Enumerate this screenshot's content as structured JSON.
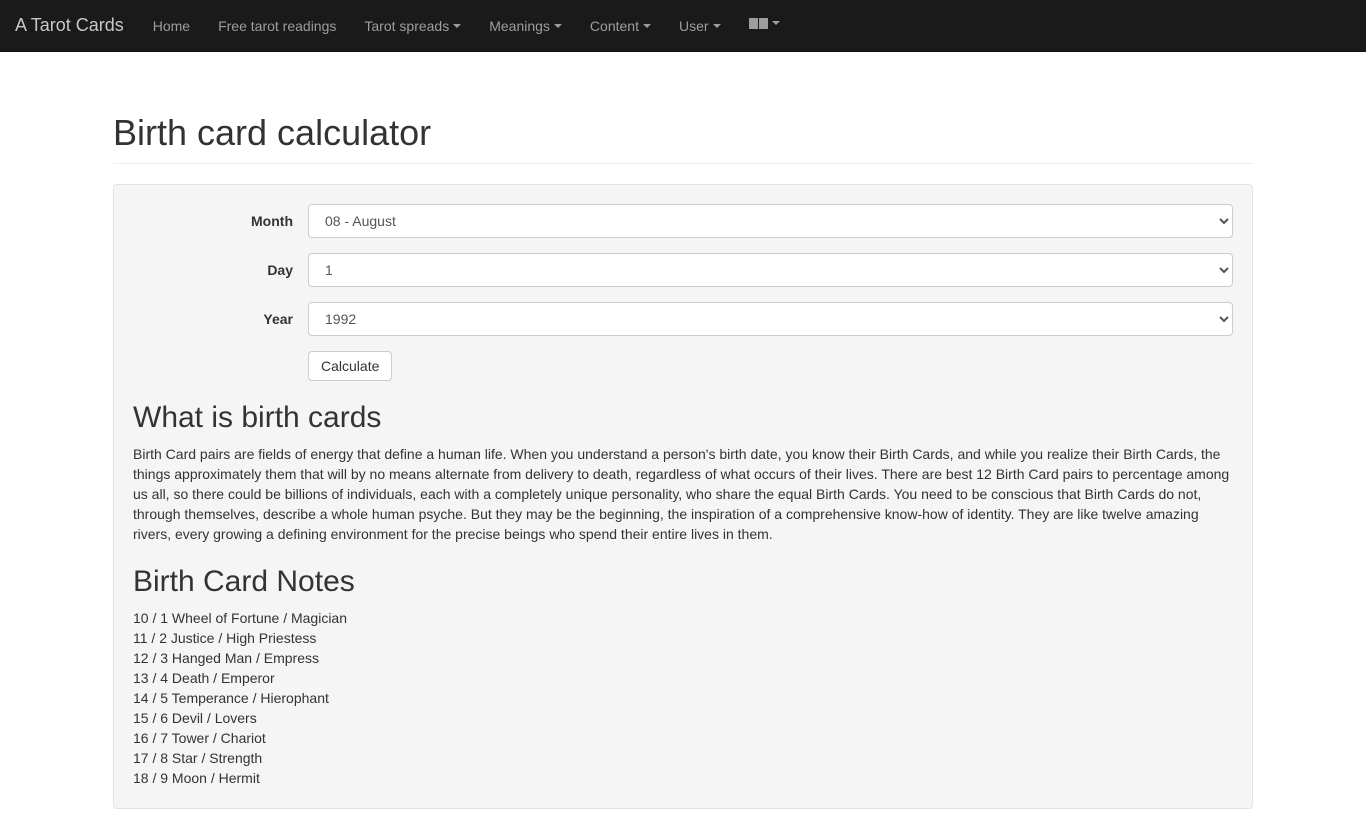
{
  "nav": {
    "brand": "A Tarot Cards",
    "items": [
      {
        "label": "Home",
        "dropdown": false
      },
      {
        "label": "Free tarot readings",
        "dropdown": false
      },
      {
        "label": "Tarot spreads",
        "dropdown": true
      },
      {
        "label": "Meanings",
        "dropdown": true
      },
      {
        "label": "Content",
        "dropdown": true
      },
      {
        "label": "User",
        "dropdown": true
      }
    ]
  },
  "page": {
    "title": "Birth card calculator"
  },
  "form": {
    "month_label": "Month",
    "month_value": "08 - August",
    "day_label": "Day",
    "day_value": "1",
    "year_label": "Year",
    "year_value": "1992",
    "submit_label": "Calculate"
  },
  "sections": {
    "what_is": {
      "heading": "What is birth cards",
      "body": "Birth Card pairs are fields of energy that define a human life. When you understand a person's birth date, you know their Birth Cards, and while you realize their Birth Cards, the things approximately them that will by no means alternate from delivery to death, regardless of what occurs of their lives. There are best 12 Birth Card pairs to percentage among us all, so there could be billions of individuals, each with a completely unique personality, who share the equal Birth Cards. You need to be conscious that Birth Cards do not, through themselves, describe a whole human psyche. But they may be the beginning, the inspiration of a comprehensive know-how of identity. They are like twelve amazing rivers, every growing a defining environment for the precise beings who spend their entire lives in them."
    },
    "notes": {
      "heading": "Birth Card Notes",
      "items": [
        "10 / 1 Wheel of Fortune / Magician",
        "11 / 2 Justice / High Priestess",
        "12 / 3 Hanged Man / Empress",
        "13 / 4 Death / Emperor",
        "14 / 5 Temperance / Hierophant",
        "15 / 6 Devil / Lovers",
        "16 / 7 Tower / Chariot",
        "17 / 8 Star / Strength",
        "18 / 9 Moon / Hermit"
      ]
    }
  }
}
